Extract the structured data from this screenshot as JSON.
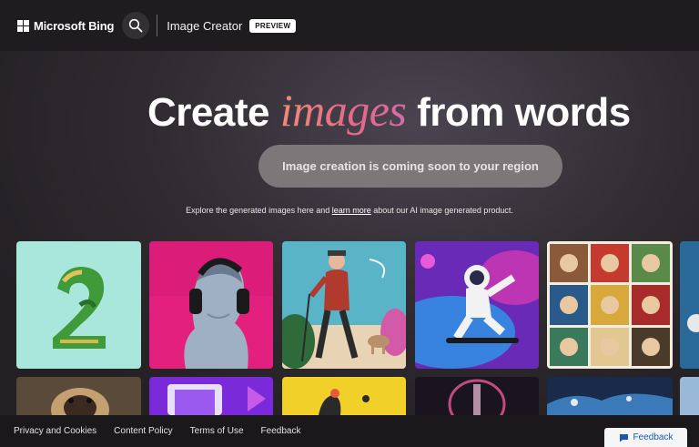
{
  "header": {
    "brand": "Microsoft Bing",
    "product": "Image Creator",
    "badge": "PREVIEW",
    "icons": {
      "logo": "microsoft-logo",
      "search": "search-icon"
    }
  },
  "hero": {
    "headline_before": "Create",
    "headline_accent": "images",
    "headline_after": "from words",
    "status": "Image creation is coming soon to your region",
    "explore_before": "Explore the generated images here and",
    "explore_link": "learn more",
    "explore_after": "about our AI image generated product."
  },
  "colors": {
    "accent_gradient_start": "#f08a7a",
    "accent_gradient_end": "#d86aa8",
    "background": "#232024",
    "status_pill": "#7c7879"
  },
  "gallery": {
    "tiles": [
      "number-2-leaves",
      "bust-with-headphones",
      "elderly-man-walking-dog",
      "astronaut-skateboard",
      "portrait-grid",
      "pug",
      "purple-tech",
      "yellow-still-life",
      "space-glow",
      "night-landscape",
      "edge-tile"
    ]
  },
  "footer": {
    "links": [
      "Privacy and Cookies",
      "Content Policy",
      "Terms of Use",
      "Feedback"
    ],
    "feedback_button": "Feedback"
  }
}
